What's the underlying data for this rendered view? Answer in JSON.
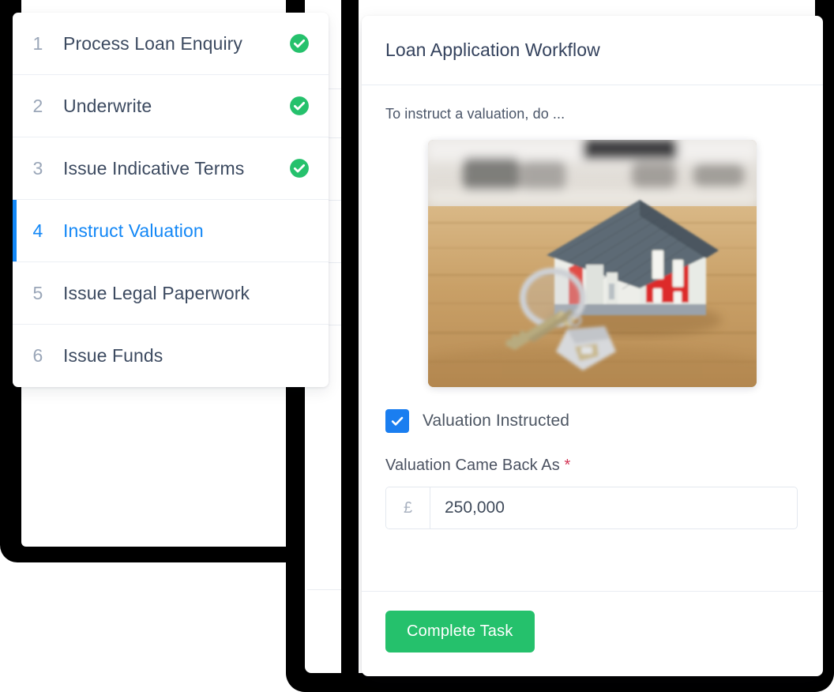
{
  "steps_panel": {
    "steps": [
      {
        "number": "1",
        "label": "Process Loan Enquiry",
        "state": "done"
      },
      {
        "number": "2",
        "label": "Underwrite",
        "state": "done"
      },
      {
        "number": "3",
        "label": "Issue Indicative Terms",
        "state": "done"
      },
      {
        "number": "4",
        "label": "Instruct Valuation",
        "state": "active"
      },
      {
        "number": "5",
        "label": "Issue Legal Paperwork",
        "state": "todo"
      },
      {
        "number": "6",
        "label": "Issue Funds",
        "state": "todo"
      }
    ],
    "done_icon": "check-circle-icon",
    "active_accent": "#1287f6",
    "done_color": "#25c16c"
  },
  "task_panel": {
    "title": "Loan Application Workflow",
    "instruction": "To instruct a valuation, do ...",
    "image": {
      "name": "house-model-with-keys-photo",
      "alt": "Model house with keys on a wooden table"
    },
    "checkbox": {
      "label": "Valuation Instructed",
      "checked": true,
      "color": "#1a7ef0"
    },
    "field": {
      "label": "Valuation Came Back As",
      "required_marker": "*",
      "currency_prefix": "£",
      "value": "250,000",
      "placeholder": "0"
    },
    "primary_button": {
      "label": "Complete Task",
      "color": "#25c16c"
    }
  }
}
